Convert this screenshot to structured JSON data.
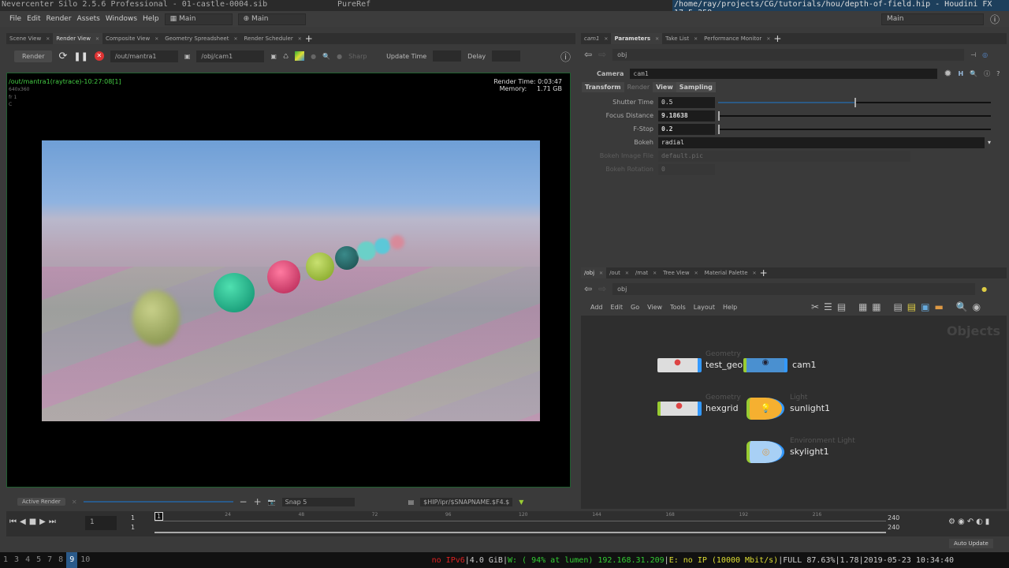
{
  "titlebar": {
    "left": "Nevercenter Silo 2.5.6 Professional - 01-castle-0004.sib",
    "center": "PureRef",
    "right": "/home/ray/projects/CG/tutorials/hou/depth-of-field.hip - Houdini FX 17.5.258"
  },
  "menu": [
    "File",
    "Edit",
    "Render",
    "Assets",
    "Windows",
    "Help"
  ],
  "desktop_selectors": [
    "Main",
    "Main"
  ],
  "right_desktop": "Main",
  "left_tabs": [
    "Scene View",
    "Render View",
    "Composite View",
    "Geometry Spreadsheet",
    "Render Scheduler"
  ],
  "render_toolbar": {
    "render": "Render",
    "rop": "/out/mantra1",
    "camera": "/obj/cam1",
    "sharp": "Sharp",
    "update_time": "Update Time",
    "delay": "Delay"
  },
  "render_info": {
    "name": "/out/mantra1(raytrace)-10:27:08[1]",
    "res": "640x360",
    "frame": "fr 1",
    "channel": "C",
    "render_time_label": "Render Time:",
    "render_time": "0:03:47",
    "memory_label": "Memory:",
    "memory": "1.71 GB"
  },
  "render_bottom": {
    "active_render": "Active Render",
    "snap": "Snap 5",
    "path": "$HIP/ipr/$SNAPNAME.$F4.$"
  },
  "param_tabs": [
    "cam1",
    "Parameters",
    "Take List",
    "Performance Monitor"
  ],
  "param_path": "obj",
  "camera": {
    "type": "Camera",
    "name": "cam1"
  },
  "param_subtabs": [
    "Transform",
    "Render",
    "View",
    "Sampling"
  ],
  "params": [
    {
      "label": "Shutter Time",
      "value": "0.5",
      "fraction": 0.5
    },
    {
      "label": "Focus Distance",
      "value": "9.18638",
      "fraction": 0.0
    },
    {
      "label": "F-Stop",
      "value": "0.2",
      "fraction": 0.0
    }
  ],
  "bokeh": {
    "label": "Bokeh",
    "value": "radial"
  },
  "bokeh_image": {
    "label": "Bokeh Image File",
    "value": "default.pic"
  },
  "bokeh_rotation": {
    "label": "Bokeh Rotation",
    "value": "0"
  },
  "net_tabs": [
    "/obj",
    "/out",
    "/mat",
    "Tree View",
    "Material Palette"
  ],
  "net_path": "obj",
  "net_menu": [
    "Add",
    "Edit",
    "Go",
    "View",
    "Tools",
    "Layout",
    "Help"
  ],
  "net_context": "Objects",
  "nodes": [
    {
      "type": "Geometry",
      "name": "test_geo"
    },
    {
      "type": "",
      "name": "cam1"
    },
    {
      "type": "Geometry",
      "name": "hexgrid"
    },
    {
      "type": "Light",
      "name": "sunlight1"
    },
    {
      "type": "Environment Light",
      "name": "skylight1"
    }
  ],
  "timeline": {
    "frame": "1",
    "start": "1",
    "start2": "1",
    "current": "1",
    "end": "240",
    "end2": "240",
    "ticks": [
      "24",
      "48",
      "72",
      "96",
      "120",
      "144",
      "168",
      "192",
      "216"
    ],
    "auto_update": "Auto Update"
  },
  "taskbar": {
    "workspaces": [
      "1",
      "3",
      "4",
      "5",
      "7",
      "8",
      "9",
      "10"
    ],
    "active": "9",
    "ipv6": "no IPv6",
    "mem": "4.0 GiB",
    "wifi": "W: ( 94% at lumen) 192.168.31.209",
    "eth": "E: no IP (10000 Mbit/s)",
    "battery": "FULL 87.63%",
    "load": "1.78",
    "datetime": "2019-05-23 10:34:40"
  }
}
